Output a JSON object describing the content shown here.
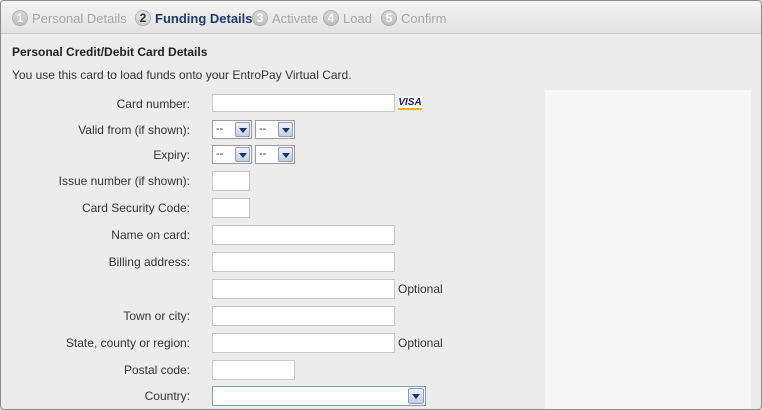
{
  "steps": [
    {
      "number": "1",
      "label": "Personal Details"
    },
    {
      "number": "2",
      "label": "Funding Details"
    },
    {
      "number": "3",
      "label": "Activate"
    },
    {
      "number": "4",
      "label": "Load"
    },
    {
      "number": "5",
      "label": "Confirm"
    }
  ],
  "active_step": 2,
  "section": {
    "heading": "Personal Credit/Debit Card Details",
    "intro": "You use this card to load funds onto your EntroPay Virtual Card."
  },
  "form": {
    "card_number_label": "Card number:",
    "card_brand_badge": "VISA",
    "valid_from_label": "Valid from (if shown):",
    "valid_from_month": "--",
    "valid_from_year": "--",
    "expiry_label": "Expiry:",
    "expiry_month": "--",
    "expiry_year": "--",
    "issue_number_label": "Issue number (if shown):",
    "security_code_label": "Card Security Code:",
    "name_on_card_label": "Name on card:",
    "billing_address_label": "Billing address:",
    "billing_address_optional": "Optional",
    "town_label": "Town or city:",
    "state_label": "State, county or region:",
    "state_optional": "Optional",
    "postal_code_label": "Postal code:",
    "country_label": "Country:"
  },
  "colors": {
    "active_step": "#1f3a6e",
    "inactive_step": "#a6a6a6",
    "background": "#ececec",
    "side_panel": "#f7f7f7"
  }
}
